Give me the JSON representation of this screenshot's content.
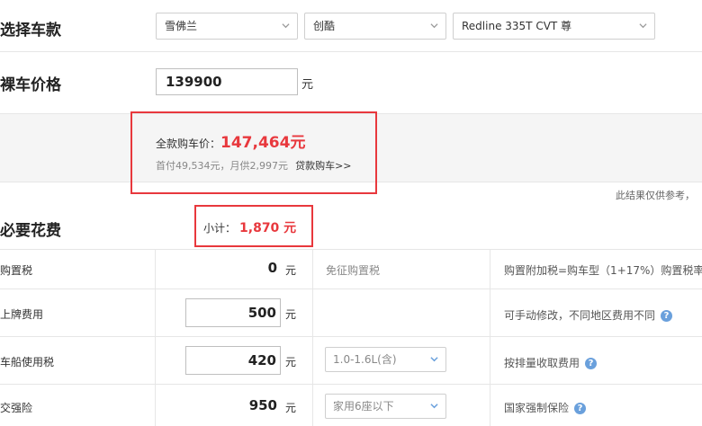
{
  "select_model": {
    "title": "选择车款",
    "brand": "雪佛兰",
    "series": "创酷",
    "model": "Redline 335T CVT 尊"
  },
  "bare_price": {
    "title": "裸车价格",
    "value": "139900",
    "unit": "元"
  },
  "summary": {
    "total_label": "全款购车价：",
    "total_value": "147,464元",
    "installment_text": "首付49,534元，月供2,997元",
    "loan_link": "贷款购车>>",
    "disclaimer": "此结果仅供参考，"
  },
  "required": {
    "title": "必要花费",
    "subtotal_label": "小计：",
    "subtotal_value": "1,870 元",
    "rows": [
      {
        "label": "购置税",
        "value": "0",
        "unit": "元",
        "middle": "免征购置税",
        "note": "购置附加税=购车型（1+17%）购置税率"
      },
      {
        "label": "上牌费用",
        "value": "500",
        "unit": "元",
        "middle": "",
        "note": "可手动修改，不同地区费用不同"
      },
      {
        "label": "车船使用税",
        "value": "420",
        "unit": "元",
        "middle": "1.0-1.6L(含)",
        "note": "按排量收取费用"
      },
      {
        "label": "交强险",
        "value": "950",
        "unit": "元",
        "middle": "家用6座以下",
        "note": "国家强制保险"
      }
    ]
  },
  "icons": {
    "help": "question-circle-icon",
    "dropdown": "chevron-down-icon"
  },
  "colors": {
    "accent_red": "#e8383d",
    "help_blue": "#6aa0dc"
  }
}
